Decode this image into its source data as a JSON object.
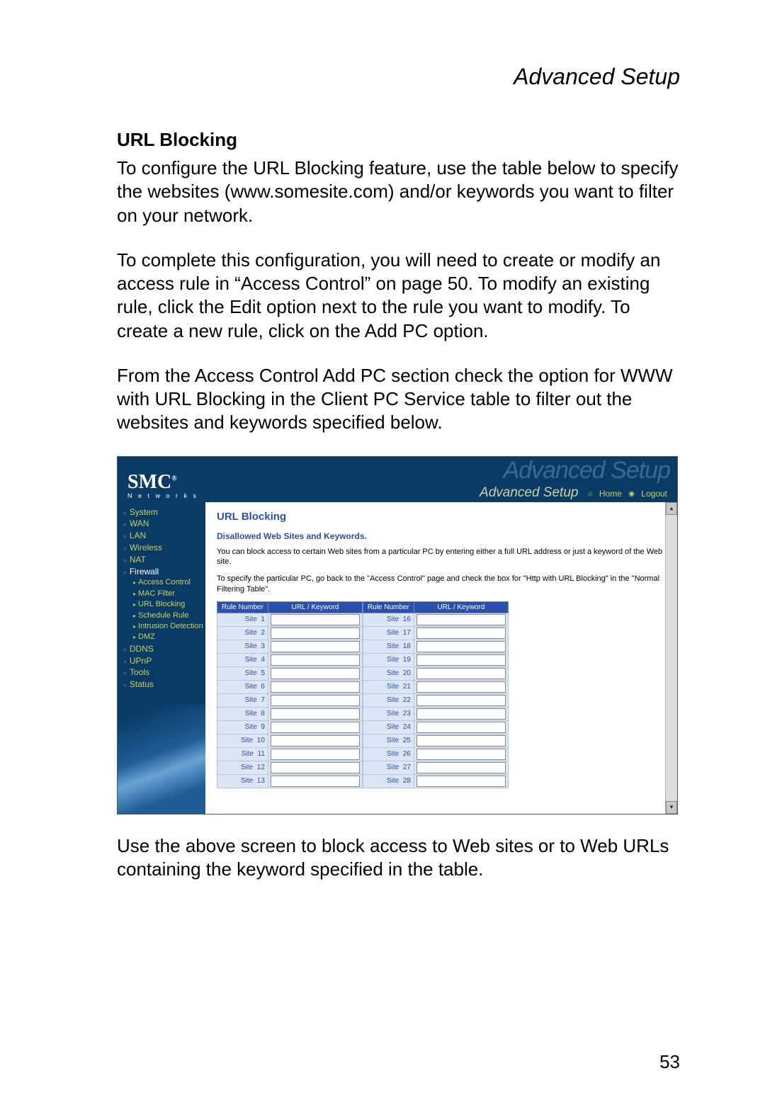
{
  "page": {
    "header": "Advanced Setup",
    "section_title": "URL Blocking",
    "p1": "To configure the URL Blocking feature, use the table below to specify the websites (www.somesite.com) and/or keywords you want to filter on your network.",
    "p2": "To complete this configuration, you will need to create or modify an access rule in “Access Control” on page 50. To modify an existing rule, click the Edit option next to the rule you want to modify. To create a new rule, click on the Add PC option.",
    "p3": "From the Access Control Add PC section check the option for WWW with URL Blocking in the Client PC Service table to filter out the websites and keywords specified below.",
    "p4": "Use the above screen to block access to Web sites or to Web URLs containing the keyword specified in the table.",
    "number": "53"
  },
  "shot": {
    "logo": "SMC",
    "logo_reg": "®",
    "logo_sub": "N e t w o r k s",
    "ghost": "Advanced Setup",
    "bar_title": "Advanced Setup",
    "home": "Home",
    "logout": "Logout",
    "sidebar": {
      "items": [
        {
          "label": "System",
          "cls": "top"
        },
        {
          "label": "WAN",
          "cls": "top"
        },
        {
          "label": "LAN",
          "cls": "top"
        },
        {
          "label": "Wireless",
          "cls": "top"
        },
        {
          "label": "NAT",
          "cls": "top"
        },
        {
          "label": "Firewall",
          "cls": "top act"
        },
        {
          "label": "Access Control",
          "cls": "sub"
        },
        {
          "label": "MAC Filter",
          "cls": "sub"
        },
        {
          "label": "URL Blocking",
          "cls": "sub sel"
        },
        {
          "label": "Schedule Rule",
          "cls": "sub"
        },
        {
          "label": "Intrusion Detection",
          "cls": "sub"
        },
        {
          "label": "DMZ",
          "cls": "sub"
        },
        {
          "label": "DDNS",
          "cls": "top"
        },
        {
          "label": "UPnP",
          "cls": "top"
        },
        {
          "label": "Tools",
          "cls": "top"
        },
        {
          "label": "Status",
          "cls": "top"
        }
      ]
    },
    "main": {
      "title": "URL Blocking",
      "subtitle": "Disallowed Web Sites and Keywords.",
      "p1": "You can block access to certain Web sites from a particular PC by entering either a full URL address or just a keyword of the Web site.",
      "p2": "To specify the particular PC, go back to the \"Access Control\" page and check the box for \"Http with URL Blocking\" in the \"Normal Filtering Table\".",
      "th_rule": "Rule Number",
      "th_url": "URL / Keyword",
      "site_prefix": "Site",
      "left_start": 1,
      "right_start": 16,
      "row_count": 13
    }
  }
}
